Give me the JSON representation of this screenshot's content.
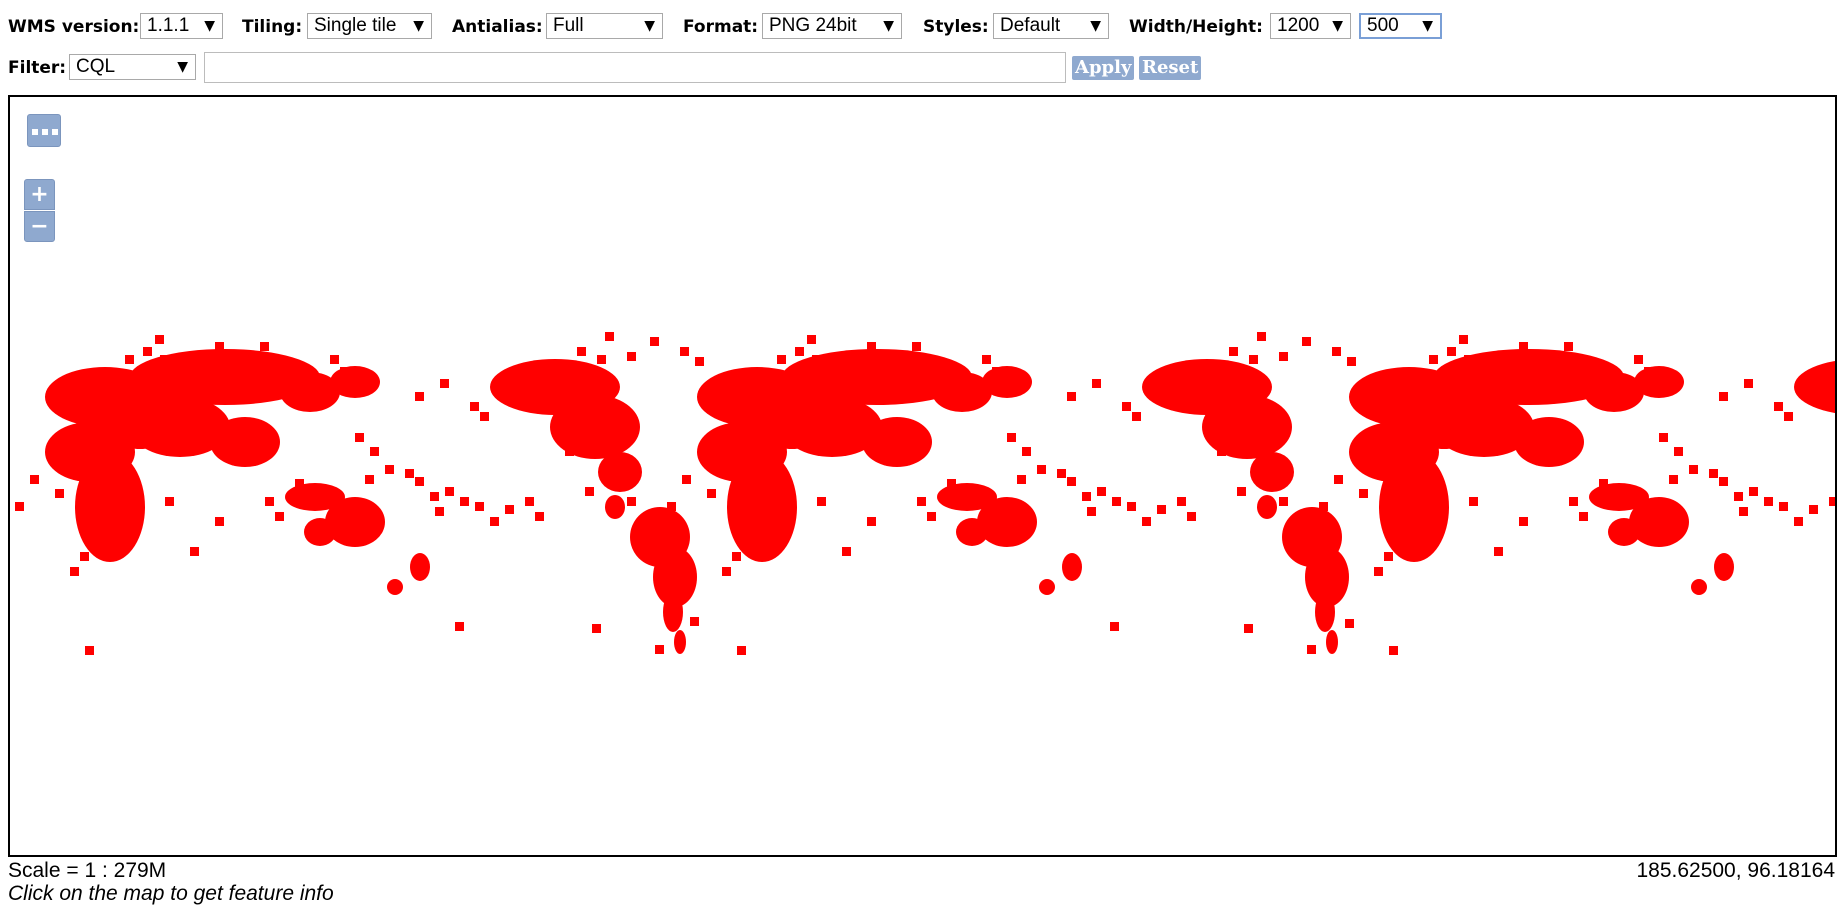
{
  "toolbar": {
    "wms_version": {
      "label": "WMS version:",
      "value": "1.1.1"
    },
    "tiling": {
      "label": "Tiling:",
      "value": "Single tile"
    },
    "antialias": {
      "label": "Antialias:",
      "value": "Full"
    },
    "format": {
      "label": "Format:",
      "value": "PNG 24bit"
    },
    "styles": {
      "label": "Styles:",
      "value": "Default"
    },
    "size": {
      "label": "Width/Height:",
      "width": "1200",
      "height": "500"
    }
  },
  "filter": {
    "label": "Filter:",
    "type": "CQL",
    "query": "",
    "apply_label": "Apply",
    "reset_label": "Reset"
  },
  "map": {
    "feature_color": "#ff0000",
    "background": "#ffffff",
    "zoom_in_label": "+",
    "zoom_out_label": "−",
    "controls_color": "#8fa9cf"
  },
  "status": {
    "scale": "Scale = 1 : 279M",
    "coordinates": "185.62500, 96.18164",
    "hint": "Click on the map to get feature info"
  }
}
